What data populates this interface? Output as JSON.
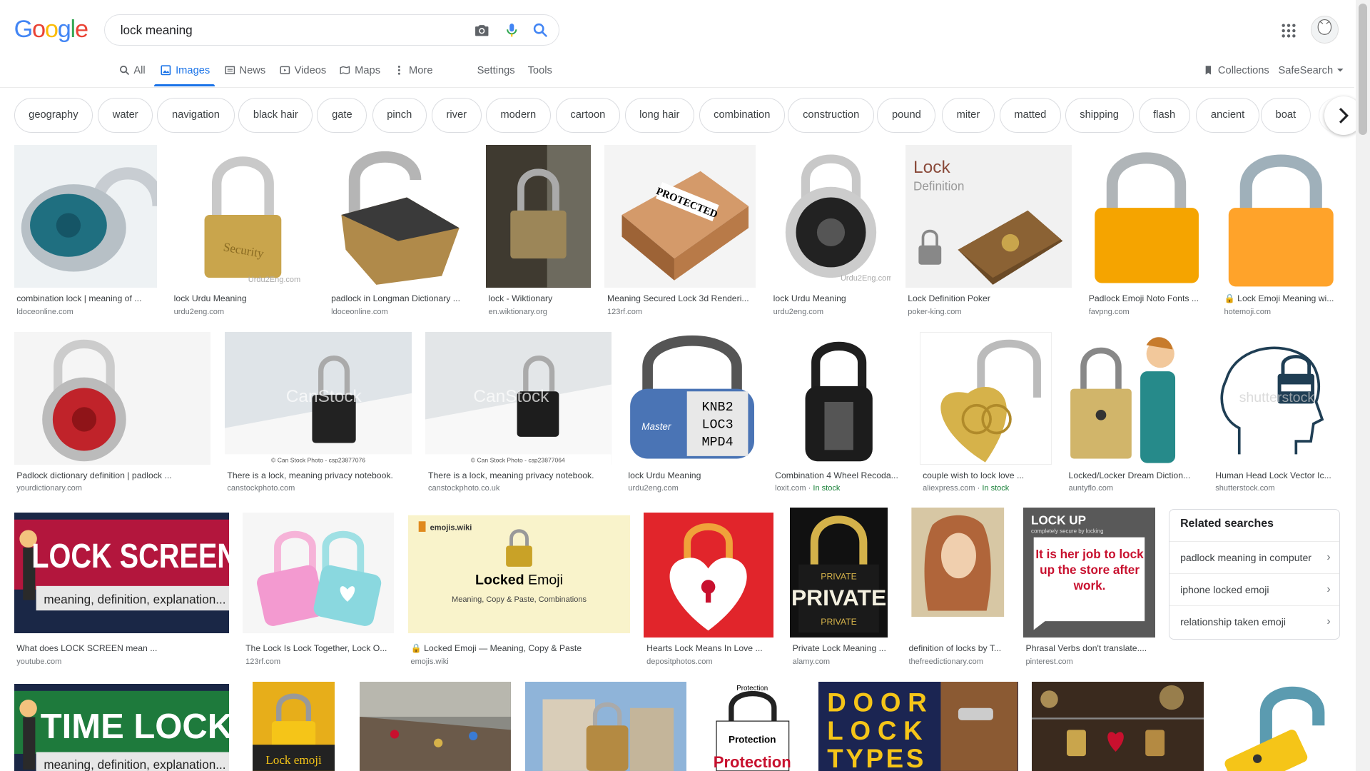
{
  "logo": {
    "letters": [
      "G",
      "o",
      "o",
      "g",
      "l",
      "e"
    ],
    "colors": [
      "#4285f4",
      "#ea4335",
      "#fbbc05",
      "#4285f4",
      "#34a853",
      "#ea4335"
    ]
  },
  "search": {
    "query": "lock meaning",
    "icons": [
      "camera-icon",
      "microphone-icon",
      "search-icon"
    ]
  },
  "nav": {
    "tabs": [
      {
        "label": "All",
        "icon": "search-icon"
      },
      {
        "label": "Images",
        "icon": "image-icon"
      },
      {
        "label": "News",
        "icon": "news-icon"
      },
      {
        "label": "Videos",
        "icon": "video-icon"
      },
      {
        "label": "Maps",
        "icon": "map-icon"
      },
      {
        "label": "More",
        "icon": "more-vert-icon"
      }
    ],
    "settings": "Settings",
    "tools": "Tools",
    "collections": "Collections",
    "safesearch": "SafeSearch"
  },
  "chips": [
    "geography",
    "water",
    "navigation",
    "black hair",
    "gate",
    "pinch",
    "river",
    "modern",
    "cartoon",
    "long hair",
    "combination",
    "construction",
    "pound",
    "miter",
    "matted",
    "shipping",
    "flash",
    "ancient",
    "boat"
  ],
  "results": [
    {
      "title": "combination lock | meaning of ...",
      "source": "ldoceonline.com"
    },
    {
      "title": "lock Urdu Meaning",
      "source": "urdu2eng.com"
    },
    {
      "title": "padlock in Longman Dictionary ...",
      "source": "ldoceonline.com"
    },
    {
      "title": "lock - Wiktionary",
      "source": "en.wiktionary.org"
    },
    {
      "title": "Meaning Secured Lock 3d Renderi...",
      "source": "123rf.com"
    },
    {
      "title": "lock Urdu Meaning",
      "source": "urdu2eng.com"
    },
    {
      "title": "Lock Definition Poker",
      "source": "poker-king.com"
    },
    {
      "title": "Padlock Emoji Noto Fonts ...",
      "source": "favpng.com"
    },
    {
      "title": "🔒 Lock Emoji Meaning wi...",
      "source": "hotemoji.com"
    },
    {
      "title": "Padlock dictionary definition | padlock ...",
      "source": "yourdictionary.com"
    },
    {
      "title": "There is a lock, meaning privacy notebook.",
      "source": "canstockphoto.com"
    },
    {
      "title": "There is a lock, meaning privacy notebook.",
      "source": "canstockphoto.co.uk"
    },
    {
      "title": "lock Urdu Meaning",
      "source": "urdu2eng.com"
    },
    {
      "title": "Combination 4 Wheel Recoda...",
      "source": "loxit.com",
      "stock": "In stock"
    },
    {
      "title": "couple wish to lock love ...",
      "source": "aliexpress.com",
      "stock": "In stock"
    },
    {
      "title": "Locked/Locker Dream Diction...",
      "source": "auntyflo.com"
    },
    {
      "title": "Human Head Lock Vector Ic...",
      "source": "shutterstock.com"
    },
    {
      "title": "What does LOCK SCREEN mean ...",
      "source": "youtube.com"
    },
    {
      "title": "The Lock Is Lock Together, Lock O...",
      "source": "123rf.com"
    },
    {
      "title": "🔒 Locked Emoji — Meaning, Copy & Paste",
      "source": "emojis.wiki"
    },
    {
      "title": "Hearts Lock Means In Love ...",
      "source": "depositphotos.com"
    },
    {
      "title": "Private Lock Meaning ...",
      "source": "alamy.com"
    },
    {
      "title": "definition of locks by T...",
      "source": "thefreedictionary.com"
    },
    {
      "title": "Phrasal Verbs don't translate....",
      "source": "pinterest.com"
    }
  ],
  "image_text": {
    "lock_def_title": "Lock",
    "lock_def_sub": "Definition",
    "protected": "PROTECTED",
    "lock_screen": "LOCK SCREEN",
    "lock_screen_sub": "meaning, definition, explanation...",
    "time_lock": "TIME LOCK",
    "time_lock_sub": "meaning, definition, explanation...",
    "emojis_wiki": "emojis.wiki",
    "locked": "Locked",
    "emoji": " Emoji",
    "locked_sub": "Meaning, Copy & Paste, Combinations",
    "lock_up": "LOCK UP",
    "lock_up_sub": "completely secure by locking",
    "lock_up_sentence": "It is her job to lock up the store after work.",
    "private": "PRIVATE",
    "door": "DOOR",
    "lock": "LOCK",
    "types": "TYPES",
    "lock_emoji": "Lock emoji",
    "protection": "Protection",
    "master": "Master",
    "knb2": "KNB2",
    "loc3": "LOC3",
    "mpd4": "MPD4",
    "watermark_urdu": "Urdu2Eng.com",
    "watermark_canstock": "CanStock",
    "watermark_shutter": "shutterstock",
    "canstock_caption1": "© Can Stock Photo - csp23877076",
    "canstock_caption2": "© Can Stock Photo - csp23877064",
    "security": "Security"
  },
  "related": {
    "heading": "Related searches",
    "items": [
      "padlock meaning in computer",
      "iphone locked emoji",
      "relationship taken emoji"
    ]
  },
  "colors": {
    "accent": "#1a73e8",
    "in_stock": "#188038"
  }
}
